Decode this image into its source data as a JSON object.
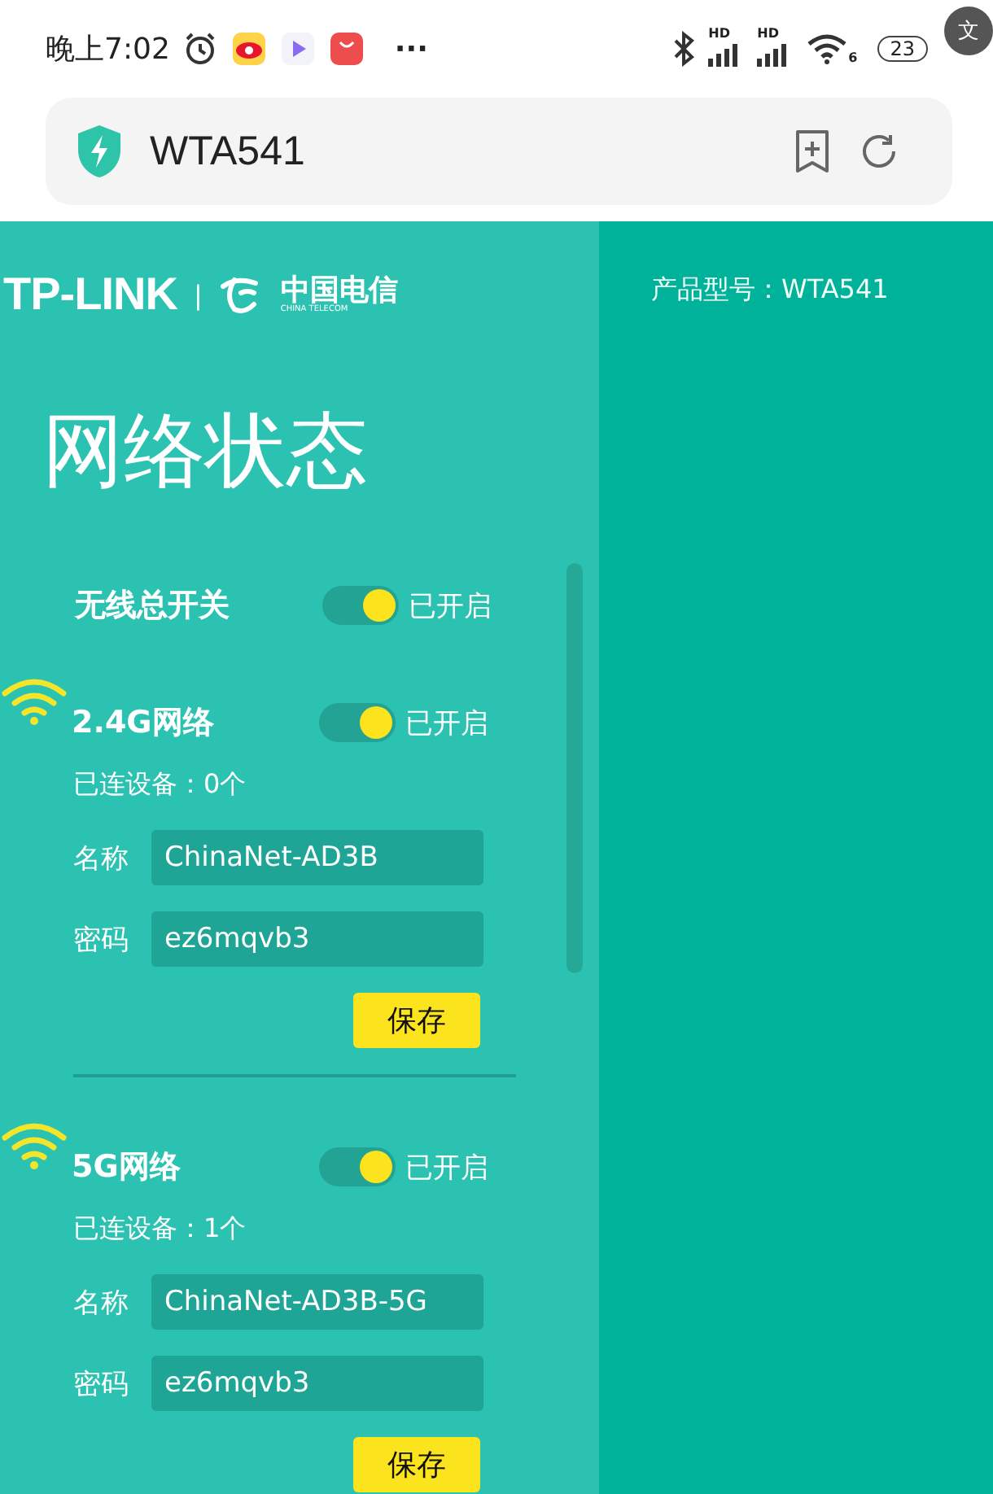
{
  "status_bar": {
    "time": "晚上7:02",
    "more": "···",
    "signal_labels": [
      "HD",
      "HD"
    ],
    "wifi_label": "6",
    "battery": "23",
    "translate": "文"
  },
  "address_bar": {
    "url": "WTA541"
  },
  "header": {
    "brand": "TP-LINK",
    "separator": "|",
    "partner": "中国电信",
    "partner_sub": "CHINA TELECOM",
    "product_model": "产品型号：WTA541"
  },
  "page_title": "网络状态",
  "master_switch": {
    "label": "无线总开关",
    "on": true,
    "status": "已开启"
  },
  "networks": [
    {
      "name": "2.4G网络",
      "on": true,
      "status": "已开启",
      "devices": "已连设备：0个",
      "fields": [
        {
          "label": "名称",
          "value": "ChinaNet-AD3B"
        },
        {
          "label": "密码",
          "value": "ez6mqvb3"
        }
      ],
      "save": "保存"
    },
    {
      "name": "5G网络",
      "on": true,
      "status": "已开启",
      "devices": "已连设备：1个",
      "fields": [
        {
          "label": "名称",
          "value": "ChinaNet-AD3B-5G"
        },
        {
          "label": "密码",
          "value": "ez6mqvb3"
        }
      ],
      "save": "保存"
    }
  ]
}
